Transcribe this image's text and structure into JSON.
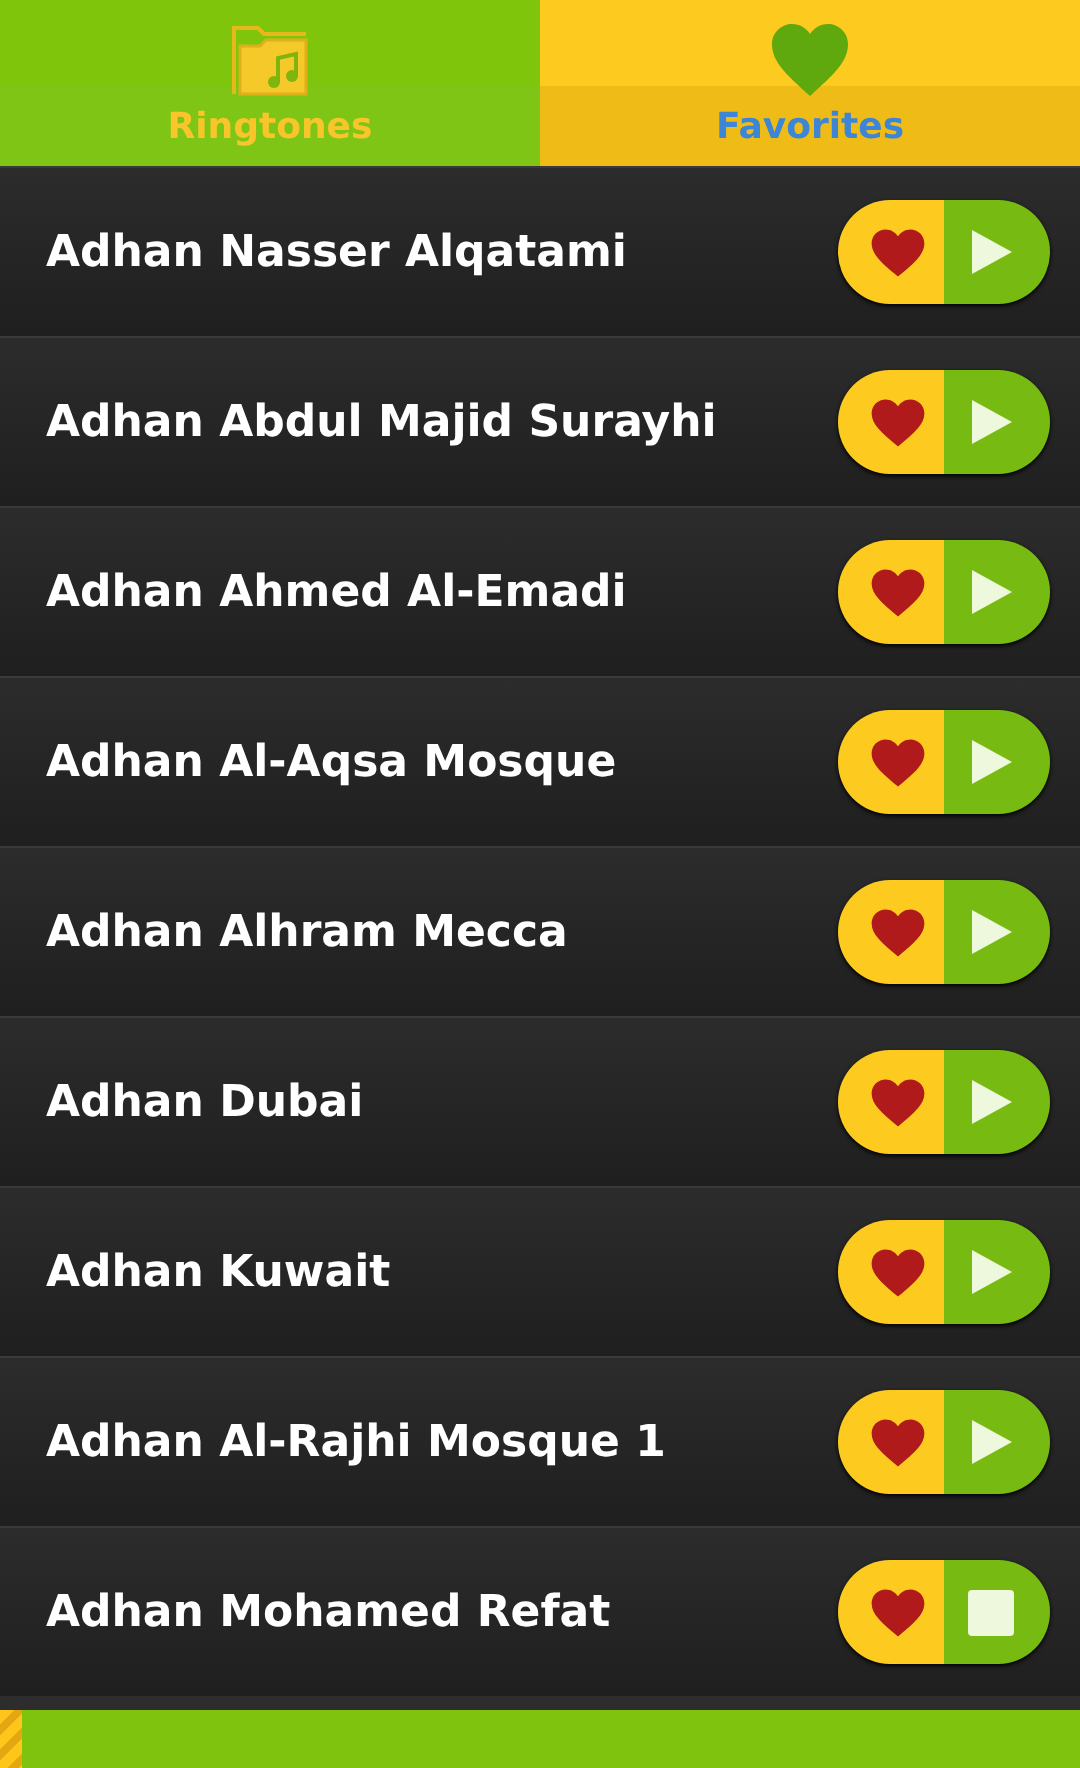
{
  "tabs": [
    {
      "label": "Ringtones",
      "selected": false
    },
    {
      "label": "Favorites",
      "selected": true
    }
  ],
  "rows": [
    {
      "title": "Adhan Nasser Alqatami",
      "favorite": true,
      "playing": false
    },
    {
      "title": "Adhan Abdul Majid Surayhi",
      "favorite": true,
      "playing": false
    },
    {
      "title": "Adhan Ahmed Al-Emadi",
      "favorite": true,
      "playing": false
    },
    {
      "title": "Adhan Al-Aqsa Mosque",
      "favorite": true,
      "playing": false
    },
    {
      "title": "Adhan Alhram Mecca",
      "favorite": true,
      "playing": false
    },
    {
      "title": "Adhan Dubai",
      "favorite": true,
      "playing": false
    },
    {
      "title": "Adhan Kuwait",
      "favorite": true,
      "playing": false
    },
    {
      "title": "Adhan Al-Rajhi Mosque 1",
      "favorite": true,
      "playing": false
    },
    {
      "title": "Adhan Mohamed Refat",
      "favorite": true,
      "playing": true
    }
  ],
  "progress": {
    "level": 0.02
  }
}
